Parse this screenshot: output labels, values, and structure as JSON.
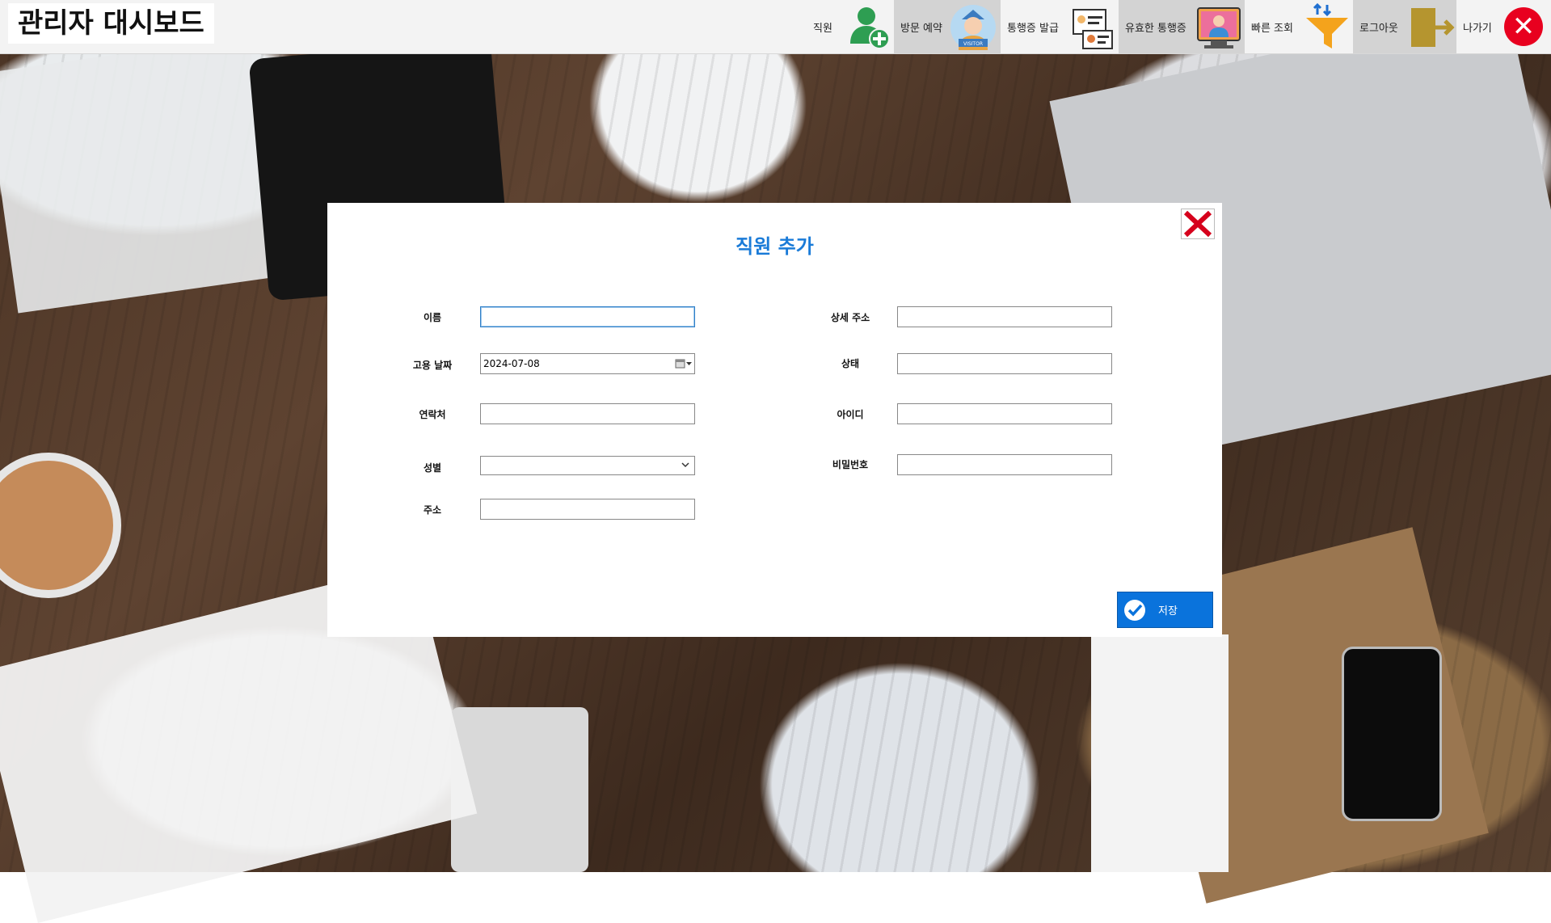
{
  "app": {
    "title": "관리자 대시보드"
  },
  "nav": {
    "items": [
      {
        "label": "직원",
        "icon": "add-user-icon"
      },
      {
        "label": "방문 예약",
        "icon": "visitor-icon",
        "icon_text": "VISITOR"
      },
      {
        "label": "통행증 발급",
        "icon": "pass-card-icon"
      },
      {
        "label": "유효한 통행증",
        "icon": "valid-pass-icon"
      },
      {
        "label": "빠른 조회",
        "icon": "filter-icon"
      },
      {
        "label": "로그아웃",
        "icon": "logout-icon"
      },
      {
        "label": "나가기",
        "icon": "exit-icon"
      }
    ]
  },
  "modal": {
    "title": "직원 추가",
    "fields": {
      "name": {
        "label": "이름",
        "value": ""
      },
      "hire_date": {
        "label": "고용 날짜",
        "value": "2024-07-08"
      },
      "contact": {
        "label": "연락처",
        "value": ""
      },
      "gender": {
        "label": "성별",
        "value": ""
      },
      "address": {
        "label": "주소",
        "value": ""
      },
      "detail_address": {
        "label": "상세 주소",
        "value": ""
      },
      "status": {
        "label": "상태",
        "value": ""
      },
      "user_id": {
        "label": "아이디",
        "value": ""
      },
      "password": {
        "label": "비밀번호",
        "value": ""
      }
    },
    "save_label": "저장"
  },
  "colors": {
    "accent": "#1a7bd8",
    "save_button": "#0a73dc",
    "exit": "#e8001f",
    "close_x": "#d6001c"
  }
}
